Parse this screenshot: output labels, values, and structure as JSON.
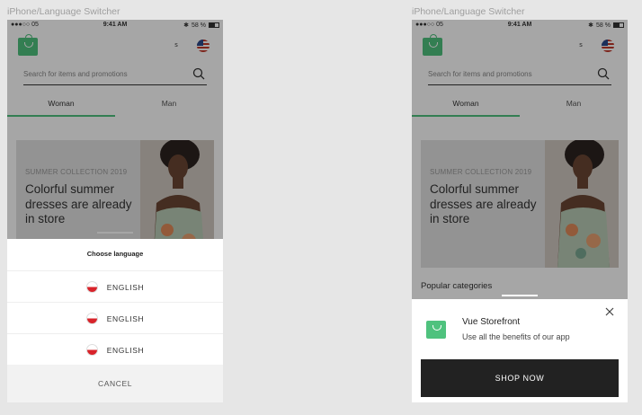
{
  "frames": [
    {
      "label": "iPhone/Language Switcher",
      "status": {
        "carrier": "●●●○○ 05",
        "time": "9:41 AM",
        "battery": "58 %"
      },
      "header": {
        "currency": "s"
      },
      "search": {
        "placeholder": "Search for items and promotions"
      },
      "tabs": [
        {
          "label": "Woman"
        },
        {
          "label": "Man"
        }
      ],
      "hero": {
        "eyebrow": "SUMMER COLLECTION 2019",
        "title": "Colorful summer dresses are already in store"
      },
      "language_sheet": {
        "title": "Choose language",
        "languages": [
          {
            "label": "ENGLISH"
          },
          {
            "label": "ENGLISH"
          },
          {
            "label": "ENGLISH"
          }
        ],
        "cancel_label": "CANCEL"
      }
    },
    {
      "label": "iPhone/Language Switcher",
      "status": {
        "carrier": "●●●○○ 05",
        "time": "9:41 AM",
        "battery": "58 %"
      },
      "header": {
        "currency": "s"
      },
      "search": {
        "placeholder": "Search for items and promotions"
      },
      "tabs": [
        {
          "label": "Woman"
        },
        {
          "label": "Man"
        }
      ],
      "hero": {
        "eyebrow": "SUMMER COLLECTION 2019",
        "title": "Colorful summer dresses are already in store"
      },
      "popular_heading": "Popular categories",
      "app_banner": {
        "title": "Vue Storefront",
        "subtitle": "Use all the benefits of our app",
        "button_label": "SHOP NOW"
      }
    }
  ],
  "colors": {
    "brand": "#4fc27e",
    "dark": "#222222",
    "sheet": "#ffffff"
  },
  "icons": [
    "bag-logo-icon",
    "us-flag-icon",
    "search-icon",
    "polish-flag-icon",
    "close-icon",
    "battery-icon",
    "bluetooth-icon"
  ]
}
